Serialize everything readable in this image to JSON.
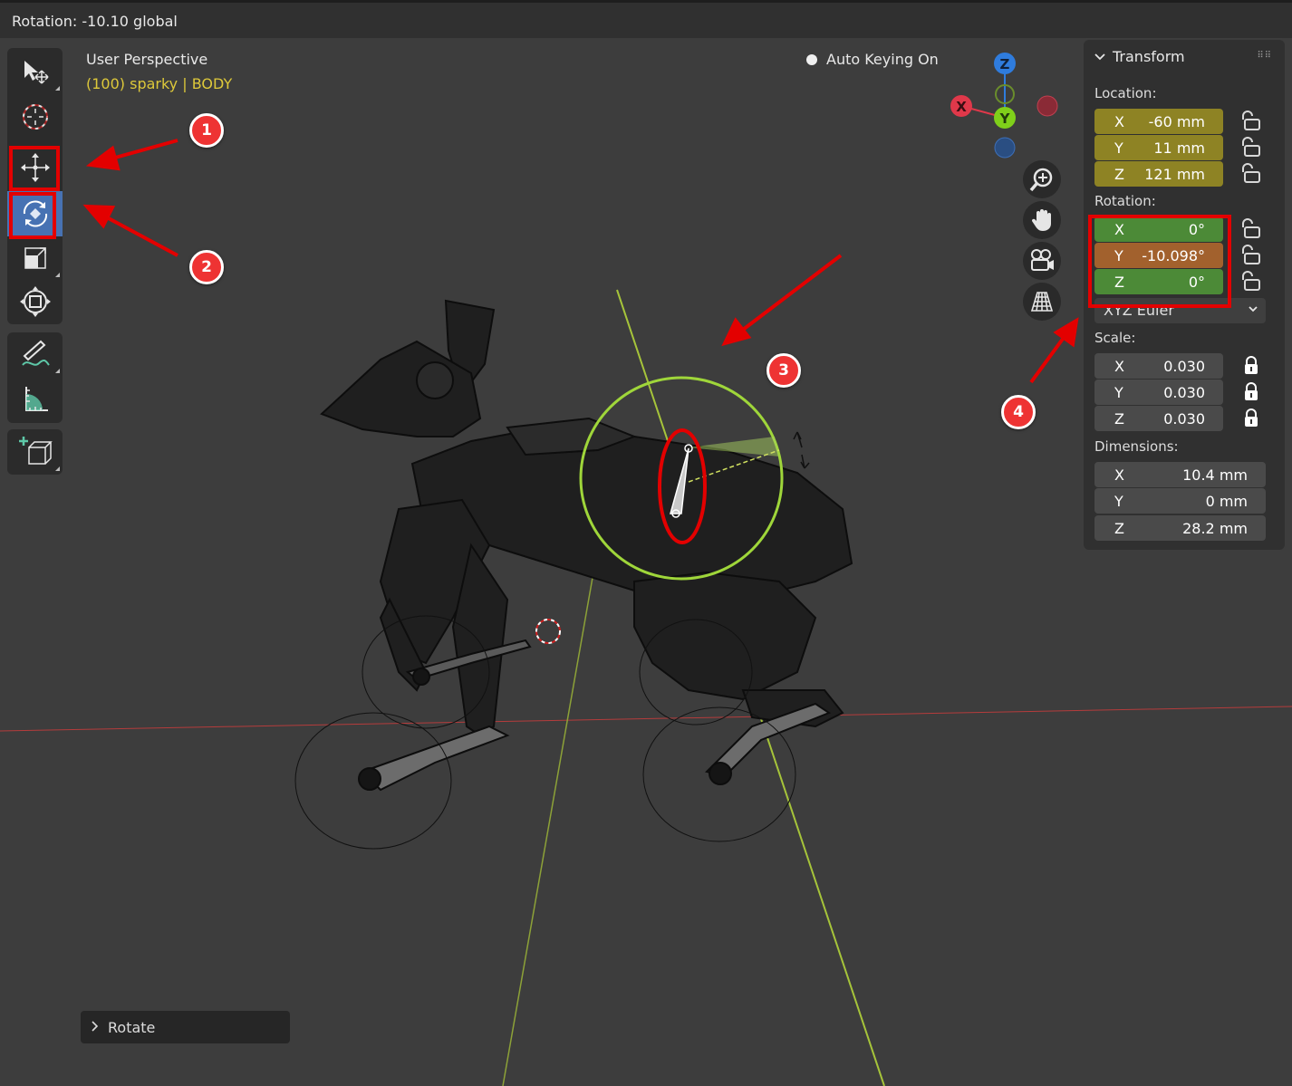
{
  "header": {
    "status": "Rotation: -10.10 global"
  },
  "viewport": {
    "title": "User Perspective",
    "subtitle": "(100) sparky | BODY",
    "auto_keying": "Auto Keying On"
  },
  "gizmo": {
    "x": "X",
    "y": "Y",
    "z": "Z"
  },
  "toolbar": {
    "tools": [
      "select-box",
      "cursor",
      "move",
      "rotate",
      "scale",
      "transform",
      "annotate",
      "measure",
      "add-cube"
    ],
    "active_tool": "rotate"
  },
  "navigation": [
    "zoom",
    "pan",
    "camera",
    "perspective-toggle"
  ],
  "transform_panel": {
    "title": "Transform",
    "location": {
      "label": "Location:",
      "x": {
        "axis": "X",
        "value": "-60 mm"
      },
      "y": {
        "axis": "Y",
        "value": "11 mm"
      },
      "z": {
        "axis": "Z",
        "value": "121 mm"
      }
    },
    "rotation": {
      "label": "Rotation:",
      "x": {
        "axis": "X",
        "value": "0°"
      },
      "y": {
        "axis": "Y",
        "value": "-10.098°"
      },
      "z": {
        "axis": "Z",
        "value": "0°"
      },
      "mode": "XYZ Euler"
    },
    "scale": {
      "label": "Scale:",
      "x": {
        "axis": "X",
        "value": "0.030"
      },
      "y": {
        "axis": "Y",
        "value": "0.030"
      },
      "z": {
        "axis": "Z",
        "value": "0.030"
      }
    },
    "dimensions": {
      "label": "Dimensions:",
      "x": {
        "axis": "X",
        "value": "10.4 mm"
      },
      "y": {
        "axis": "Y",
        "value": "0 mm"
      },
      "z": {
        "axis": "Z",
        "value": "28.2 mm"
      }
    }
  },
  "annotations": {
    "b1": "1",
    "b2": "2",
    "b3": "3",
    "b4": "4"
  },
  "last_operation": {
    "label": "Rotate"
  },
  "colors": {
    "x_axis": "#e0384a",
    "y_axis": "#7fcf1a",
    "z_axis": "#2f7cdd",
    "annotation_red": "#e30000",
    "location_field": "#8e8324",
    "rotation_field": "#4c8a37",
    "keyed_field": "#a2612d"
  }
}
